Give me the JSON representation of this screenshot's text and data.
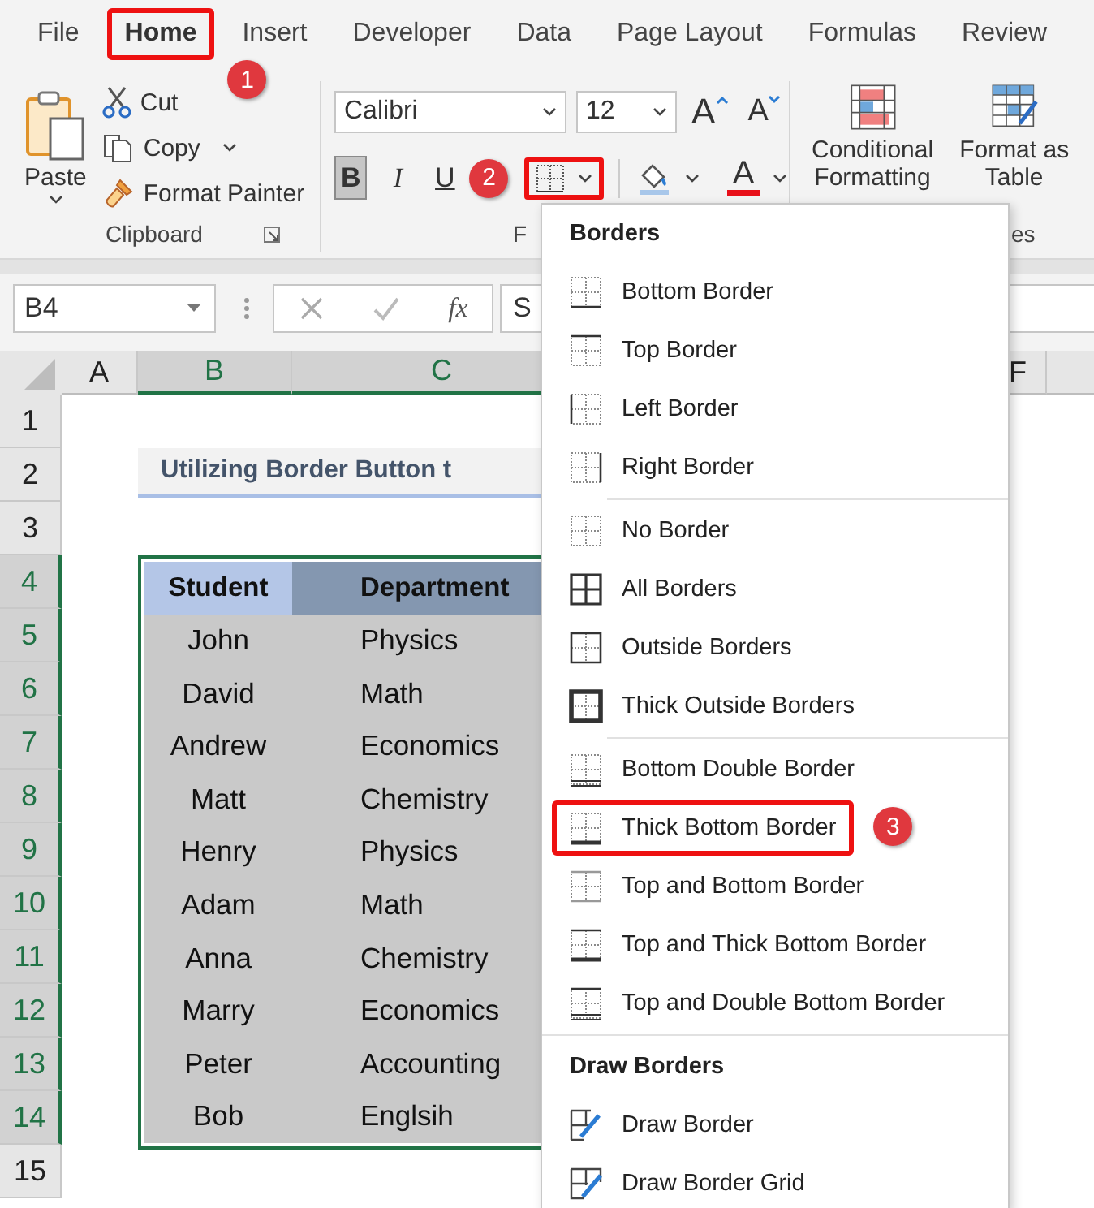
{
  "tabs": [
    {
      "label": "File",
      "selected": false,
      "highlighted": false
    },
    {
      "label": "Home",
      "selected": true,
      "highlighted": true,
      "step": "1"
    },
    {
      "label": "Insert",
      "selected": false,
      "highlighted": false
    },
    {
      "label": "Developer",
      "selected": false,
      "highlighted": false
    },
    {
      "label": "Data",
      "selected": false,
      "highlighted": false
    },
    {
      "label": "Page Layout",
      "selected": false,
      "highlighted": false
    },
    {
      "label": "Formulas",
      "selected": false,
      "highlighted": false
    },
    {
      "label": "Review",
      "selected": false,
      "highlighted": false
    }
  ],
  "ribbon": {
    "clipboard": {
      "paste": "Paste",
      "cut": "Cut",
      "copy": "Copy",
      "format_painter": "Format Painter",
      "label": "Clipboard"
    },
    "font": {
      "font_name": "Calibri",
      "font_size": "12",
      "grow": "A",
      "shrink": "A",
      "bold": {
        "text": "B",
        "pressed": true
      },
      "italic": {
        "text": "I",
        "pressed": false
      },
      "underline": {
        "text": "U",
        "pressed": false
      },
      "borders_button": {
        "highlighted": true,
        "step": "2"
      },
      "font_color": "A",
      "label": "F"
    },
    "styles": {
      "conditional_formatting": [
        "Conditional",
        "Formatting"
      ],
      "format_as_table": [
        "Format as",
        "Table"
      ],
      "label": "es"
    }
  },
  "formula_bar": {
    "name_box": "B4",
    "insert_function": "fx",
    "formula_text": "S"
  },
  "sheet": {
    "columns": [
      {
        "label": "A",
        "selected": false
      },
      {
        "label": "B",
        "selected": true
      },
      {
        "label": "C",
        "selected": true
      },
      {
        "label": "F",
        "selected": false
      }
    ],
    "rows": [
      {
        "label": "1",
        "selected": false
      },
      {
        "label": "2",
        "selected": false
      },
      {
        "label": "3",
        "selected": false
      },
      {
        "label": "4",
        "selected": true
      },
      {
        "label": "5",
        "selected": true
      },
      {
        "label": "6",
        "selected": true
      },
      {
        "label": "7",
        "selected": true
      },
      {
        "label": "8",
        "selected": true
      },
      {
        "label": "9",
        "selected": true
      },
      {
        "label": "10",
        "selected": true
      },
      {
        "label": "11",
        "selected": true
      },
      {
        "label": "12",
        "selected": true
      },
      {
        "label": "13",
        "selected": true
      },
      {
        "label": "14",
        "selected": true
      },
      {
        "label": "15",
        "selected": false
      }
    ],
    "title": "Utilizing Border Button t",
    "table": {
      "headers": [
        "Student",
        "Department"
      ],
      "rows": [
        [
          "John",
          "Physics"
        ],
        [
          "David",
          "Math"
        ],
        [
          "Andrew",
          "Economics"
        ],
        [
          "Matt",
          "Chemistry"
        ],
        [
          "Henry",
          "Physics"
        ],
        [
          "Adam",
          "Math"
        ],
        [
          "Anna",
          "Chemistry"
        ],
        [
          "Marry",
          "Economics"
        ],
        [
          "Peter",
          "Accounting"
        ],
        [
          "Bob",
          "Englsih"
        ]
      ]
    }
  },
  "borders_menu": {
    "sections": [
      {
        "title": "Borders",
        "groups": [
          [
            {
              "label": "Bottom Border",
              "kind": "bottom",
              "highlighted": false
            },
            {
              "label": "Top Border",
              "kind": "top",
              "highlighted": false
            },
            {
              "label": "Left Border",
              "kind": "left",
              "highlighted": false
            },
            {
              "label": "Right Border",
              "kind": "right",
              "highlighted": false
            }
          ],
          [
            {
              "label": "No Border",
              "kind": "none",
              "highlighted": false
            },
            {
              "label": "All Borders",
              "kind": "all",
              "highlighted": false
            },
            {
              "label": "Outside Borders",
              "kind": "outside",
              "highlighted": false
            },
            {
              "label": "Thick Outside Borders",
              "kind": "thick-outside",
              "highlighted": false
            }
          ],
          [
            {
              "label": "Bottom Double Border",
              "kind": "bottom-double",
              "highlighted": false
            },
            {
              "label": "Thick Bottom Border",
              "kind": "thick-bottom",
              "highlighted": true,
              "step": "3"
            },
            {
              "label": "Top and Bottom Border",
              "kind": "top-bottom",
              "highlighted": false
            },
            {
              "label": "Top and Thick Bottom Border",
              "kind": "top-thick-bottom",
              "highlighted": false
            },
            {
              "label": "Top and Double Bottom Border",
              "kind": "top-double-bottom",
              "highlighted": false
            }
          ]
        ]
      },
      {
        "title": "Draw Borders",
        "groups": [
          [
            {
              "label": "Draw Border",
              "kind": "draw",
              "highlighted": false
            },
            {
              "label": "Draw Border Grid",
              "kind": "draw-grid",
              "highlighted": false
            }
          ]
        ]
      }
    ]
  }
}
